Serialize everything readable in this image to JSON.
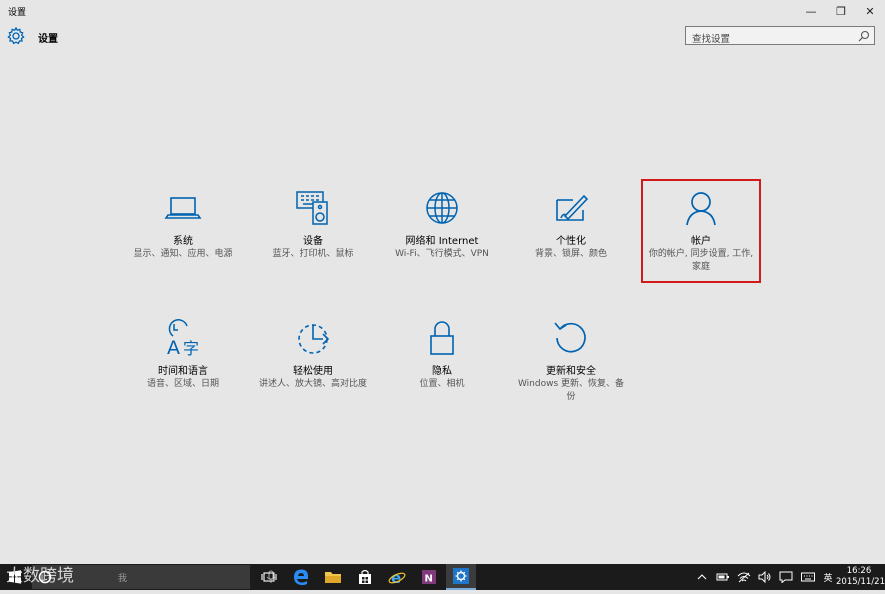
{
  "window": {
    "title": "设置",
    "buttons": [
      "minimize",
      "restore",
      "close"
    ],
    "minimize_glyph": "—",
    "restore_glyph": "❐",
    "close_glyph": "✕"
  },
  "header": {
    "title": "设置",
    "icon": "gear-icon"
  },
  "search": {
    "placeholder": "查找设置",
    "icon": "search-icon"
  },
  "colors": {
    "accent": "#0063b1",
    "background": "#e6e6e6",
    "highlight_border": "#d11a1a",
    "taskbar": "#1b1b1b"
  },
  "tiles": [
    {
      "name": "系统",
      "desc": "显示、通知、应用、电源",
      "icon": "laptop-icon"
    },
    {
      "name": "设备",
      "desc": "蓝牙、打印机、鼠标",
      "icon": "devices-icon"
    },
    {
      "name": "网络和 Internet",
      "desc": "Wi-Fi、飞行模式、VPN",
      "icon": "globe-icon"
    },
    {
      "name": "个性化",
      "desc": "背景、锁屏、颜色",
      "icon": "personalization-icon"
    },
    {
      "name": "帐户",
      "desc": "你的帐户, 同步设置, 工作, 家庭",
      "icon": "person-icon",
      "highlighted": true
    },
    {
      "name": "时间和语言",
      "desc": "语音、区域、日期",
      "icon": "time-language-icon"
    },
    {
      "name": "轻松使用",
      "desc": "讲述人、放大镜、高对比度",
      "icon": "ease-of-access-icon"
    },
    {
      "name": "隐私",
      "desc": "位置、相机",
      "icon": "lock-icon"
    },
    {
      "name": "更新和安全",
      "desc": "Windows 更新、恢复、备份",
      "icon": "update-icon"
    }
  ],
  "taskbar": {
    "search_text": "我",
    "watermark": "大数跨境",
    "apps": [
      "task-view-icon",
      "edge-icon",
      "file-explorer-icon",
      "store-icon",
      "ie-icon",
      "onenote-icon",
      "settings-icon"
    ],
    "tray_lang": "英",
    "time": "16:26",
    "date": "2015/11/21"
  }
}
